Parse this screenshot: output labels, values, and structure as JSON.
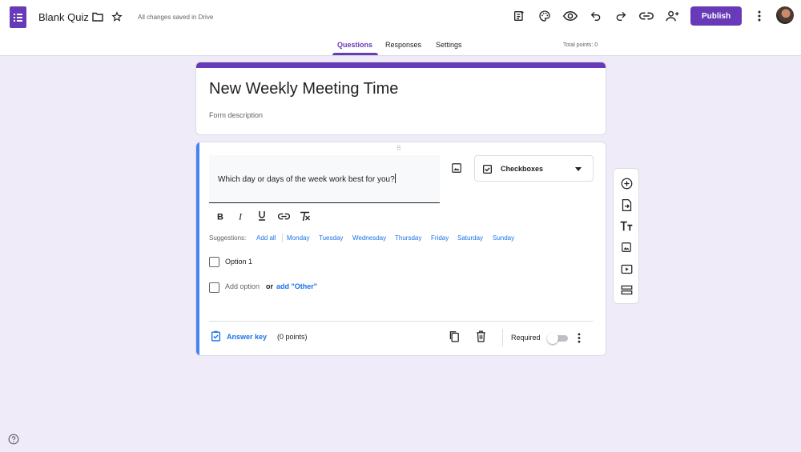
{
  "header": {
    "app_title": "Blank Quiz",
    "save_status": "All changes saved in Drive",
    "publish_label": "Publish",
    "icons": [
      "forms-logo-icon",
      "folder-icon",
      "star-icon",
      "addon-icon",
      "palette-icon",
      "preview-icon",
      "undo-icon",
      "redo-icon",
      "link-icon",
      "add-collaborator-icon",
      "more-vert-icon"
    ]
  },
  "tabs": {
    "questions": "Questions",
    "responses": "Responses",
    "settings": "Settings",
    "total_points": "Total points: 0"
  },
  "form": {
    "title": "New Weekly Meeting Time",
    "description": "Form description"
  },
  "question": {
    "text": "Which day or days of the week work best for you?",
    "type": "Checkboxes",
    "suggestions_label": "Suggestions:",
    "suggestions": [
      "Add all",
      "Monday",
      "Tuesday",
      "Wednesday",
      "Thursday",
      "Friday",
      "Saturday",
      "Sunday"
    ],
    "option_1": "Option 1",
    "add_option": "Add option",
    "or": "or",
    "add_other": "add \"Other\"",
    "answer_key": "Answer key",
    "points": "(0 points)",
    "required": "Required",
    "required_on": false
  },
  "colors": {
    "accent": "#673ab7",
    "background": "#f0ebf8",
    "link": "#1a73e8",
    "focus_bar": "#4285f4"
  }
}
